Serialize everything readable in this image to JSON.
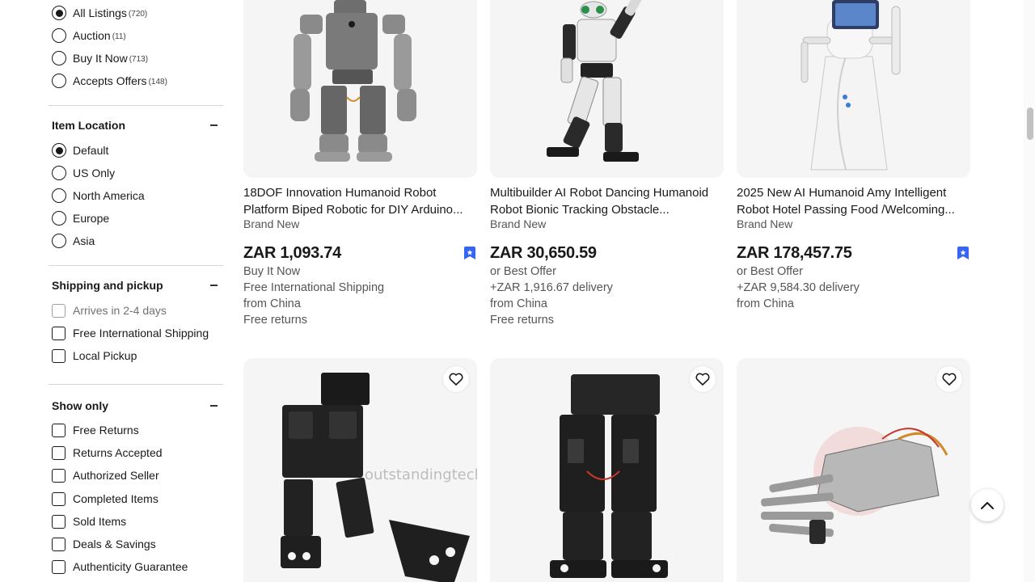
{
  "sidebar": {
    "buying_format": [
      {
        "label": "All Listings",
        "count": "(720)",
        "checked": true
      },
      {
        "label": "Auction",
        "count": "(11)",
        "checked": false
      },
      {
        "label": "Buy It Now",
        "count": "(713)",
        "checked": false
      },
      {
        "label": "Accepts Offers",
        "count": "(148)",
        "checked": false
      }
    ],
    "item_location": {
      "title": "Item Location",
      "options": [
        {
          "label": "Default",
          "checked": true
        },
        {
          "label": "US Only",
          "checked": false
        },
        {
          "label": "North America",
          "checked": false
        },
        {
          "label": "Europe",
          "checked": false
        },
        {
          "label": "Asia",
          "checked": false
        }
      ]
    },
    "shipping": {
      "title": "Shipping and pickup",
      "options": [
        {
          "label": "Arrives in 2-4 days",
          "disabled": true
        },
        {
          "label": "Free International Shipping",
          "disabled": false
        },
        {
          "label": "Local Pickup",
          "disabled": false
        }
      ]
    },
    "show_only": {
      "title": "Show only",
      "options": [
        {
          "label": "Free Returns"
        },
        {
          "label": "Returns Accepted"
        },
        {
          "label": "Authorized Seller"
        },
        {
          "label": "Completed Items"
        },
        {
          "label": "Sold Items"
        },
        {
          "label": "Deals & Savings"
        },
        {
          "label": "Authenticity Guarantee"
        }
      ]
    }
  },
  "listings": [
    {
      "title": "18DOF Innovation Humanoid Robot Platform Biped Robotic for DIY Arduino...",
      "condition": "Brand New",
      "price": "ZAR 1,093.74",
      "lines": [
        "Buy It Now",
        "Free International Shipping",
        "from China",
        "Free returns"
      ],
      "sponsored": true
    },
    {
      "title": "Multibuilder AI Robot Dancing Humanoid Robot Bionic Tracking Obstacle...",
      "condition": "Brand New",
      "price": "ZAR 30,650.59",
      "lines": [
        "or Best Offer",
        "+ZAR 1,916.67 delivery",
        "from China",
        "Free returns"
      ],
      "sponsored": false
    },
    {
      "title": "2025 New AI Humanoid Amy Intelligent Robot Hotel Passing Food /Welcoming...",
      "condition": "Brand New",
      "price": "ZAR 178,457.75",
      "lines": [
        "or Best Offer",
        "+ZAR 9,584.30 delivery",
        "from China"
      ],
      "sponsored": true
    }
  ],
  "watermark": "outstandingtecl",
  "colors": {
    "accent": "#3665f3",
    "text": "#191919",
    "muted": "#555555",
    "image_bg": "#f5f5f5"
  },
  "icons": {
    "favorite": "heart-icon",
    "back_to_top": "chevron-up-icon",
    "sponsored": "bookmark-icon",
    "collapse": "minus-icon"
  }
}
